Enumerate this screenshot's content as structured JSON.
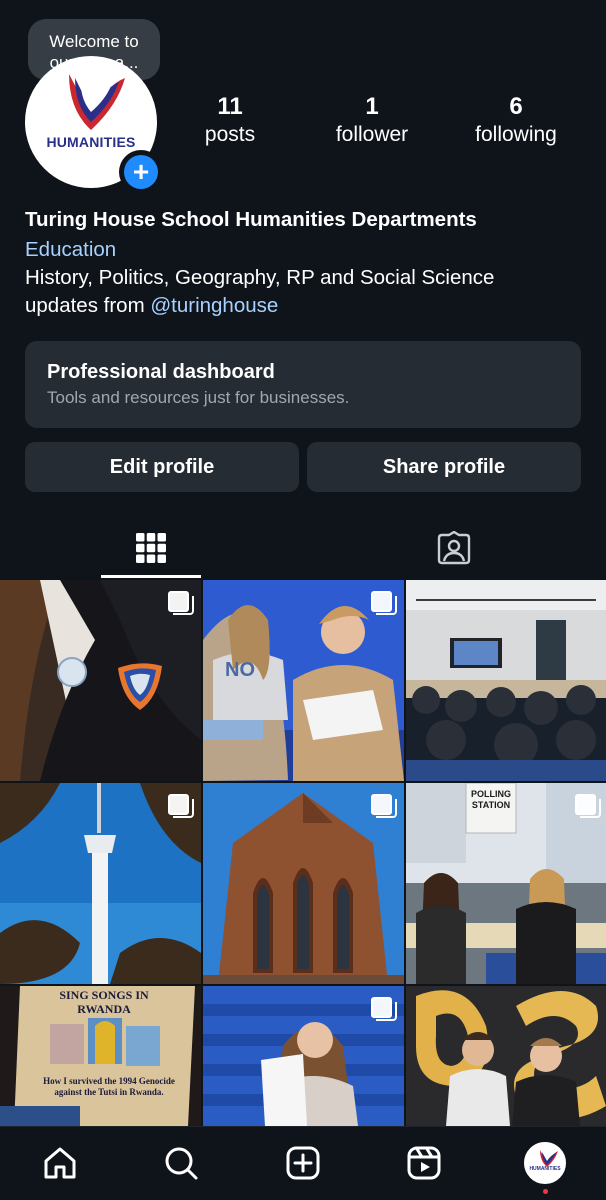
{
  "note": {
    "text": "Welcome to our new a..."
  },
  "profile": {
    "avatar_label": "HUMANITIES",
    "stats": [
      {
        "value": "11",
        "label": "posts"
      },
      {
        "value": "1",
        "label": "follower"
      },
      {
        "value": "6",
        "label": "following"
      }
    ],
    "name": "Turing House School Humanities Departments",
    "category": "Education",
    "bio_line1": "History, Politics, Geography, RP and Social Science",
    "bio_line2_prefix": "updates from ",
    "bio_mention": "@turinghouse"
  },
  "dashboard": {
    "title": "Professional dashboard",
    "subtitle": "Tools and resources just for businesses."
  },
  "buttons": {
    "edit": "Edit profile",
    "share": "Share profile"
  },
  "tabs": [
    {
      "icon": "grid-icon",
      "active": true
    },
    {
      "icon": "tagged-icon",
      "active": false
    }
  ],
  "grid": {
    "posts": [
      {
        "description": "blazer-badges",
        "multi": true
      },
      {
        "description": "students-reading-results",
        "multi": true
      },
      {
        "description": "assembly-hall",
        "multi": false
      },
      {
        "description": "tv-tower",
        "multi": true
      },
      {
        "description": "gothic-church",
        "multi": true
      },
      {
        "description": "polling-station",
        "multi": true
      },
      {
        "description": "book-cover",
        "multi": false,
        "caption_title": "SING SONGS IN RWANDA",
        "caption_sub": "How I survived the 1994 Genocide against the Tutsi in Rwanda."
      },
      {
        "description": "student-with-paper",
        "multi": true
      },
      {
        "description": "gcse-balloons",
        "multi": false
      }
    ],
    "polling_sign": "POLLING STATION"
  },
  "bottom_nav": {
    "items": [
      "home-icon",
      "search-icon",
      "create-icon",
      "reels-icon",
      "profile-avatar"
    ],
    "avatar_label": "HUMANITIES",
    "notification_color": "#ff3040"
  },
  "colors": {
    "background": "#0f141a",
    "card": "#262c33",
    "link": "#a8d1ff",
    "accent_blue": "#1f8bff"
  }
}
